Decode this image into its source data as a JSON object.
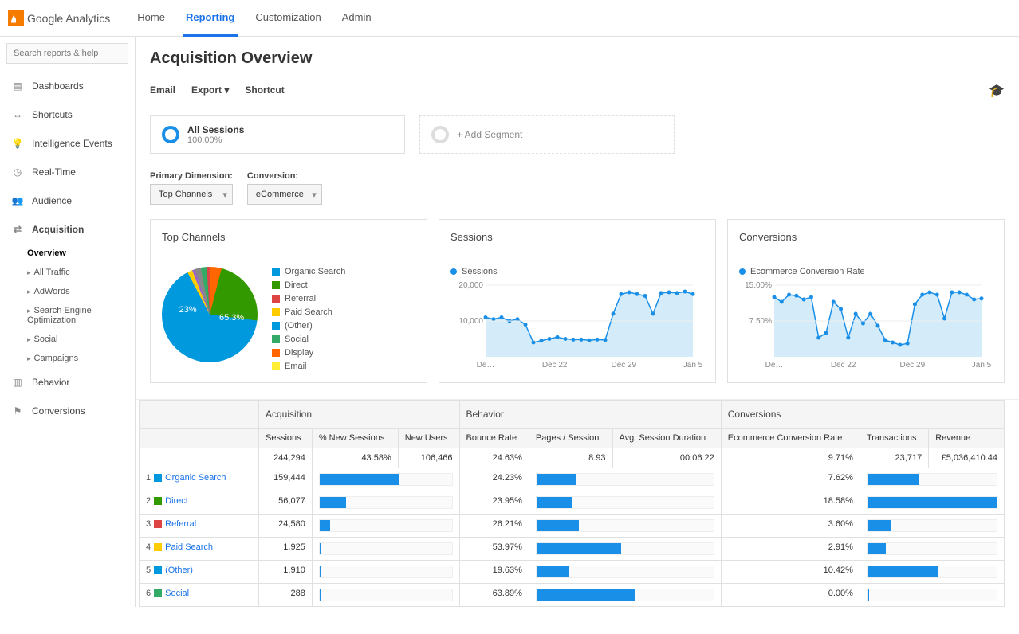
{
  "brand": "Google Analytics",
  "topnav": {
    "items": [
      "Home",
      "Reporting",
      "Customization",
      "Admin"
    ],
    "active": 1
  },
  "search_placeholder": "Search reports & help",
  "sidebar": {
    "items": [
      {
        "label": "Dashboards",
        "icon": "dashboard"
      },
      {
        "label": "Shortcuts",
        "icon": "shortcut"
      },
      {
        "label": "Intelligence Events",
        "icon": "bulb"
      },
      {
        "label": "Real-Time",
        "icon": "clock"
      },
      {
        "label": "Audience",
        "icon": "people"
      },
      {
        "label": "Acquisition",
        "icon": "share",
        "active": true,
        "children": [
          {
            "label": "Overview",
            "active": true,
            "noarrow": true
          },
          {
            "label": "All Traffic"
          },
          {
            "label": "AdWords"
          },
          {
            "label": "Search Engine Optimization"
          },
          {
            "label": "Social"
          },
          {
            "label": "Campaigns"
          }
        ]
      },
      {
        "label": "Behavior",
        "icon": "behavior"
      },
      {
        "label": "Conversions",
        "icon": "flag"
      }
    ]
  },
  "page_title": "Acquisition Overview",
  "actions": {
    "email": "Email",
    "export": "Export",
    "shortcut": "Shortcut"
  },
  "segments": {
    "all_sessions": {
      "title": "All Sessions",
      "pct": "100.00%"
    },
    "add": "+ Add Segment"
  },
  "dimensions": {
    "primary_label": "Primary Dimension:",
    "primary_value": "Top Channels",
    "conversion_label": "Conversion:",
    "conversion_value": "eCommerce"
  },
  "cards": {
    "top_channels": "Top Channels",
    "sessions": "Sessions",
    "conversions": "Conversions",
    "sessions_legend": "Sessions",
    "conversions_legend": "Ecommerce Conversion Rate"
  },
  "legend": [
    {
      "label": "Organic Search",
      "color": "#0099dd"
    },
    {
      "label": "Direct",
      "color": "#339900"
    },
    {
      "label": "Referral",
      "color": "#dd4444"
    },
    {
      "label": "Paid Search",
      "color": "#ffcc00"
    },
    {
      "label": "(Other)",
      "color": "#0099dd"
    },
    {
      "label": "Social",
      "color": "#33aa66"
    },
    {
      "label": "Display",
      "color": "#ff6600"
    },
    {
      "label": "Email",
      "color": "#ffee33"
    }
  ],
  "pie_labels": {
    "main": "65.3%",
    "second": "23%"
  },
  "chart_data": [
    {
      "type": "pie",
      "title": "Top Channels",
      "series": [
        {
          "name": "Organic Search",
          "value": 65.3
        },
        {
          "name": "Direct",
          "value": 23.0
        },
        {
          "name": "Referral",
          "value": 4.0
        },
        {
          "name": "Paid Search",
          "value": 2.0
        },
        {
          "name": "(Other)",
          "value": 2.0
        },
        {
          "name": "Social",
          "value": 1.7
        },
        {
          "name": "Display",
          "value": 1.5
        },
        {
          "name": "Email",
          "value": 0.5
        }
      ]
    },
    {
      "type": "line",
      "title": "Sessions",
      "ylabel": "Sessions",
      "ylim": [
        0,
        20000
      ],
      "x_ticks": [
        "De…",
        "Dec 22",
        "Dec 29",
        "Jan 5"
      ],
      "y_ticks": [
        "10,000",
        "20,000"
      ],
      "series": [
        {
          "name": "Sessions",
          "values": [
            11000,
            10500,
            11000,
            10000,
            10500,
            9000,
            4000,
            4500,
            5000,
            5500,
            5000,
            4800,
            4800,
            4600,
            4800,
            4700,
            12000,
            17500,
            18000,
            17500,
            17000,
            12000,
            17800,
            18000,
            17800,
            18200,
            17500
          ]
        }
      ]
    },
    {
      "type": "line",
      "title": "Ecommerce Conversion Rate",
      "ylabel": "Rate",
      "ylim": [
        0,
        0.15
      ],
      "x_ticks": [
        "De…",
        "Dec 22",
        "Dec 29",
        "Jan 5"
      ],
      "y_ticks": [
        "7.50%",
        "15.00%"
      ],
      "series": [
        {
          "name": "Ecommerce Conversion Rate",
          "values": [
            0.125,
            0.115,
            0.13,
            0.128,
            0.12,
            0.125,
            0.04,
            0.05,
            0.115,
            0.1,
            0.04,
            0.09,
            0.07,
            0.09,
            0.065,
            0.035,
            0.03,
            0.025,
            0.028,
            0.11,
            0.13,
            0.135,
            0.13,
            0.08,
            0.135,
            0.135,
            0.13,
            0.12,
            0.122
          ]
        }
      ]
    }
  ],
  "table": {
    "groups": [
      "",
      "Acquisition",
      "Behavior",
      "Conversions"
    ],
    "columns": [
      "Sessions",
      "% New Sessions",
      "New Users",
      "Bounce Rate",
      "Pages / Session",
      "Avg. Session Duration",
      "Ecommerce Conversion Rate",
      "Transactions",
      "Revenue"
    ],
    "totals": {
      "sessions": "244,294",
      "pct_new": "43.58%",
      "new_users": "106,466",
      "bounce": "24.63%",
      "pages": "8.93",
      "duration": "00:06:22",
      "ecr": "9.71%",
      "trans": "23,717",
      "revenue": "£5,036,410.44"
    },
    "rows": [
      {
        "idx": 1,
        "label": "Organic Search",
        "color": "#0099dd",
        "sessions": "159,444",
        "pct_new_bar": 60,
        "bounce": "24.23%",
        "bounce_bar": 22,
        "ecr": "7.62%",
        "ecr_bar": 40
      },
      {
        "idx": 2,
        "label": "Direct",
        "color": "#339900",
        "sessions": "56,077",
        "pct_new_bar": 20,
        "bounce": "23.95%",
        "bounce_bar": 20,
        "ecr": "18.58%",
        "ecr_bar": 100
      },
      {
        "idx": 3,
        "label": "Referral",
        "color": "#dd4444",
        "sessions": "24,580",
        "pct_new_bar": 8,
        "bounce": "26.21%",
        "bounce_bar": 24,
        "ecr": "3.60%",
        "ecr_bar": 18
      },
      {
        "idx": 4,
        "label": "Paid Search",
        "color": "#ffcc00",
        "sessions": "1,925",
        "pct_new_bar": 1,
        "bounce": "53.97%",
        "bounce_bar": 48,
        "ecr": "2.91%",
        "ecr_bar": 14
      },
      {
        "idx": 5,
        "label": "(Other)",
        "color": "#0099dd",
        "sessions": "1,910",
        "pct_new_bar": 1,
        "bounce": "19.63%",
        "bounce_bar": 18,
        "ecr": "10.42%",
        "ecr_bar": 55
      },
      {
        "idx": 6,
        "label": "Social",
        "color": "#33aa66",
        "sessions": "288",
        "pct_new_bar": 1,
        "bounce": "63.89%",
        "bounce_bar": 56,
        "ecr": "0.00%",
        "ecr_bar": 1
      }
    ]
  }
}
